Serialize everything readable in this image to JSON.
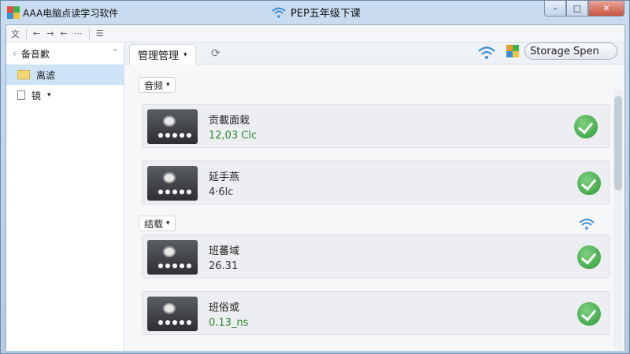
{
  "window": {
    "app_title": "AAA电脑点读学习软件",
    "center_title": "PEP五年级下课",
    "minimize": "–",
    "maximize": "□",
    "close": "✕"
  },
  "toolbar": {
    "items": [
      "文",
      "←",
      "→",
      "←",
      "⋯",
      "☰"
    ]
  },
  "sidebar": {
    "header": "备音歉",
    "items": [
      {
        "label": "离滤",
        "selected": true
      },
      {
        "label": "镜",
        "selected": false
      }
    ]
  },
  "main": {
    "tab_label": "管理管理",
    "storage_label": "Storage Spen",
    "sections": [
      {
        "label": "音频",
        "rows": [
          {
            "title": "贡載面栽",
            "subtitle": "12,03 Clc",
            "green": true
          },
          {
            "title": "延手燕",
            "subtitle": "4·6lc",
            "green": false
          }
        ]
      },
      {
        "label": "结载",
        "rows": [
          {
            "title": "班蕃域",
            "subtitle": "26.31",
            "green": false
          },
          {
            "title": "班俗或",
            "subtitle": "0.13_ns",
            "green": true
          }
        ]
      }
    ]
  },
  "colors": {
    "accent_wifi": "#3a8fd6",
    "check_green": "#2f9a3a",
    "subtitle_green": "#2b8a2b"
  }
}
